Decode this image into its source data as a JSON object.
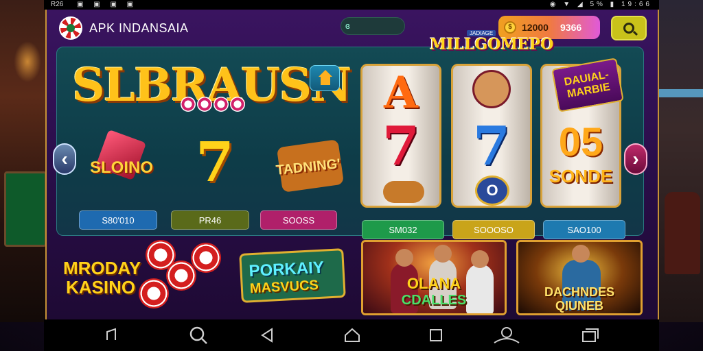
{
  "status_bar": {
    "time": "R26",
    "right_text": "5%",
    "clock": "19:66"
  },
  "header": {
    "app_title": "APK INDANSAIA",
    "search_pill_icon": "ɞ",
    "balance_coin_icon": "coin-icon",
    "balance_amount": "12000",
    "balance_bonus": "9366",
    "search_button_icon": "search-icon"
  },
  "hero": {
    "brand_title": "SLBRAUSN",
    "home_icon": "home-icon",
    "games": [
      {
        "label": "SLOINO",
        "chip": "S80'010",
        "chip_color": "#1e6ab0"
      },
      {
        "label": "7",
        "chip": "PR46",
        "chip_color": "#5a6a1a"
      },
      {
        "label": "TADNING'",
        "chip": "SOOSS",
        "chip_color": "#b0206a"
      }
    ],
    "arrow_left": "‹",
    "arrow_right": "›"
  },
  "slot_machine": {
    "banner_top": "JADIAGE",
    "banner": "MILLGOMEPO",
    "reels": [
      {
        "top": "A",
        "middle": "7",
        "chip": "SM032",
        "chip_color": "#1e9a4a"
      },
      {
        "top": "face",
        "middle": "7",
        "bottom": "O",
        "chip": "SOOOSO",
        "chip_color": "#c9a41a"
      },
      {
        "middle": "05",
        "bottom": "SONDE",
        "chip": "SAO100",
        "chip_color": "#1e7ab0"
      }
    ],
    "side_banner": "DAUIAL- MARBIE"
  },
  "promos": {
    "mroday_line1": "MRODAY",
    "mroday_line2": "KASINO",
    "porkaly_line1": "PORKAIY",
    "porkaly_line2": "MASVUCS",
    "card1_line1": "OLANA",
    "card1_line2": "CDALLES",
    "card2_line1": "DACHNDES",
    "card2_line2": "QIUNEB"
  },
  "navbar": {
    "icons": [
      "back-hook-icon",
      "search-icon",
      "back-icon",
      "home-icon",
      "recents-icon",
      "assistant-icon",
      "windows-icon"
    ]
  }
}
